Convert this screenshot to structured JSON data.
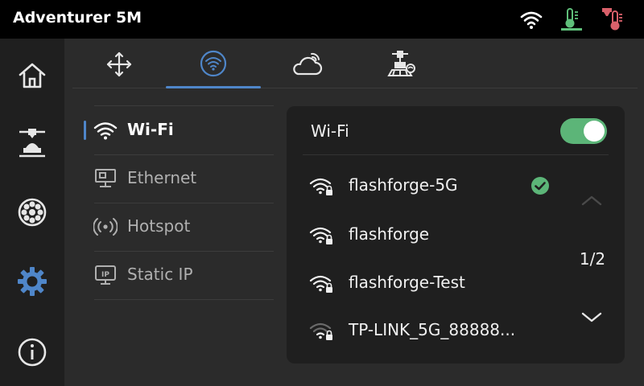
{
  "app_title": "Adventurer 5M",
  "status_icons": [
    "wifi-icon",
    "bed-temperature-icon",
    "nozzle-temperature-icon"
  ],
  "sidebar": {
    "items": [
      {
        "name": "home",
        "icon": "home-icon",
        "active": false
      },
      {
        "name": "print",
        "icon": "print-extruder-icon",
        "active": false
      },
      {
        "name": "filament",
        "icon": "filament-spool-icon",
        "active": false
      },
      {
        "name": "settings",
        "icon": "gear-icon",
        "active": true
      },
      {
        "name": "about",
        "icon": "info-icon",
        "active": false
      }
    ]
  },
  "tabs": [
    {
      "name": "move",
      "icon": "move-arrows-icon",
      "active": false
    },
    {
      "name": "network",
      "icon": "wifi-circle-icon",
      "active": true
    },
    {
      "name": "cloud",
      "icon": "cloud-icon",
      "active": false
    },
    {
      "name": "camera",
      "icon": "camera-printer-icon",
      "active": false
    }
  ],
  "network_menu": {
    "items": [
      {
        "label": "Wi-Fi",
        "icon": "wifi-icon",
        "active": true
      },
      {
        "label": "Ethernet",
        "icon": "ethernet-icon",
        "active": false
      },
      {
        "label": "Hotspot",
        "icon": "hotspot-icon",
        "active": false
      },
      {
        "label": "Static IP",
        "icon": "static-ip-icon",
        "active": false
      }
    ]
  },
  "wifi_panel": {
    "title": "Wi-Fi",
    "enabled": true,
    "networks": [
      {
        "ssid": "flashforge-5G",
        "locked": true,
        "connected": true,
        "signal": "full"
      },
      {
        "ssid": "flashforge",
        "locked": true,
        "connected": false,
        "signal": "full"
      },
      {
        "ssid": "flashforge-Test",
        "locked": true,
        "connected": false,
        "signal": "full"
      },
      {
        "ssid": "TP-LINK_5G_88888...",
        "locked": true,
        "connected": false,
        "signal": "weak"
      }
    ],
    "page": "1/2"
  },
  "colors": {
    "accent": "#4f86c9",
    "toggle_on": "#5cb578",
    "check_green": "#5cb578",
    "bed_icon": "#5fbf7a",
    "nozzle_icon": "#d9606a"
  }
}
